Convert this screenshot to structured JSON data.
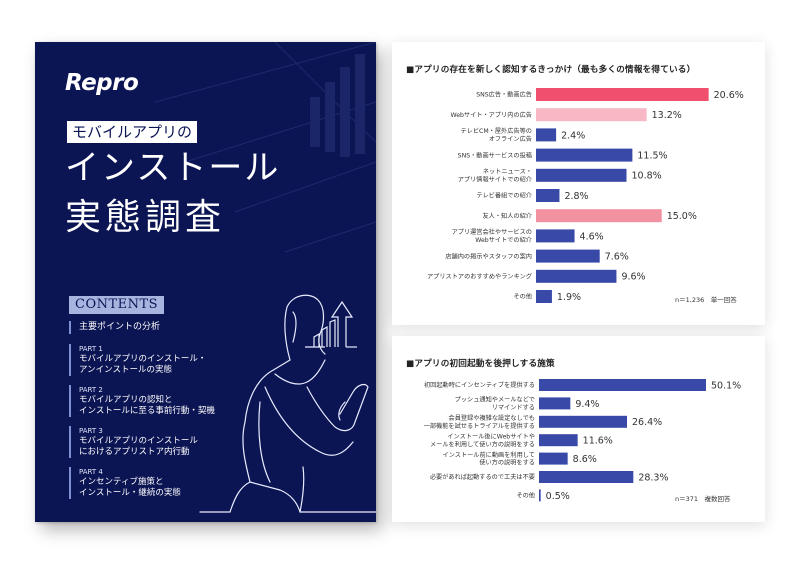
{
  "book": {
    "logo": "Repro",
    "subtitle": "モバイルアプリの",
    "title_line1": "インストール",
    "title_line2": "実態調査",
    "contents_label": "CONTENTS",
    "toc": [
      {
        "part": "",
        "lines": [
          "主要ポイントの分析"
        ]
      },
      {
        "part": "PART 1",
        "lines": [
          "モバイルアプリのインストール・",
          "アンインストールの実態"
        ]
      },
      {
        "part": "PART 2",
        "lines": [
          "モバイルアプリの認知と",
          "インストールに至る事前行動・契機"
        ]
      },
      {
        "part": "PART 3",
        "lines": [
          "モバイルアプリのインストール",
          "におけるアプリストア内行動"
        ]
      },
      {
        "part": "PART 4",
        "lines": [
          "インセンティブ施策と",
          "インストール・継続の実態"
        ]
      }
    ],
    "colors": {
      "background": "#0c1554",
      "contents_bg": "#a8b4e0",
      "toc_rule": "#7f8fd6"
    }
  },
  "chart_data": [
    {
      "type": "bar",
      "orientation": "horizontal",
      "title": "■アプリの存在を新しく認知するきっかけ（最も多くの情報を得ている）",
      "categories": [
        [
          "SNS広告・動画広告"
        ],
        [
          "Webサイト・アプリ内の広告"
        ],
        [
          "テレビCM・屋外広告等の",
          "オフライン広告"
        ],
        [
          "SNS・動画サービスの投稿"
        ],
        [
          "ネットニュース・",
          "アプリ情報サイトでの紹介"
        ],
        [
          "テレビ番組での紹介"
        ],
        [
          "友人・知人の紹介"
        ],
        [
          "アプリ運営会社やサービスの",
          "Webサイトでの紹介"
        ],
        [
          "店舗内の掲示やスタッフの案内"
        ],
        [
          "アプリストアのおすすめやランキング"
        ],
        [
          "その他"
        ]
      ],
      "values": [
        20.6,
        13.2,
        2.4,
        11.5,
        10.8,
        2.8,
        15.0,
        4.6,
        7.6,
        9.6,
        1.9
      ],
      "value_labels": [
        "20.6%",
        "13.2%",
        "2.4%",
        "11.5%",
        "10.8%",
        "2.8%",
        "15.0%",
        "4.6%",
        "7.6%",
        "9.6%",
        "1.9%"
      ],
      "bar_colors": [
        "#f0506e",
        "#f7b7c4",
        "#3949a8",
        "#3949a8",
        "#3949a8",
        "#3949a8",
        "#f2919f",
        "#3949a8",
        "#3949a8",
        "#3949a8",
        "#3949a8"
      ],
      "xlim": [
        0,
        21
      ],
      "xlabel": "",
      "ylabel": "",
      "grid": false,
      "note": "n＝1,236　単一回答"
    },
    {
      "type": "bar",
      "orientation": "horizontal",
      "title": "■アプリの初回起動を後押しする施策",
      "categories": [
        [
          "初回起動時にインセンティブを提供する"
        ],
        [
          "プッシュ通知やメールなどで",
          "リマインドする"
        ],
        [
          "会員登録や複雑な設定なしでも",
          "一部機能を試せるトライアルを提供する"
        ],
        [
          "インストール後にWebサイトや",
          "メールを利用して使い方の説明をする"
        ],
        [
          "インストール前に動画を利用して",
          "使い方の説明をする"
        ],
        [
          "必要があれば起動するので工夫は不要"
        ],
        [
          "その他"
        ]
      ],
      "values": [
        50.1,
        9.4,
        26.4,
        11.6,
        8.6,
        28.3,
        0.5
      ],
      "value_labels": [
        "50.1%",
        "9.4%",
        "26.4%",
        "11.6%",
        "8.6%",
        "28.3%",
        "0.5%"
      ],
      "bar_colors": [
        "#3949a8",
        "#3949a8",
        "#3949a8",
        "#3949a8",
        "#3949a8",
        "#3949a8",
        "#3949a8"
      ],
      "xlim": [
        0,
        51
      ],
      "xlabel": "",
      "ylabel": "",
      "grid": false,
      "note": "n＝371　複数回答"
    }
  ]
}
